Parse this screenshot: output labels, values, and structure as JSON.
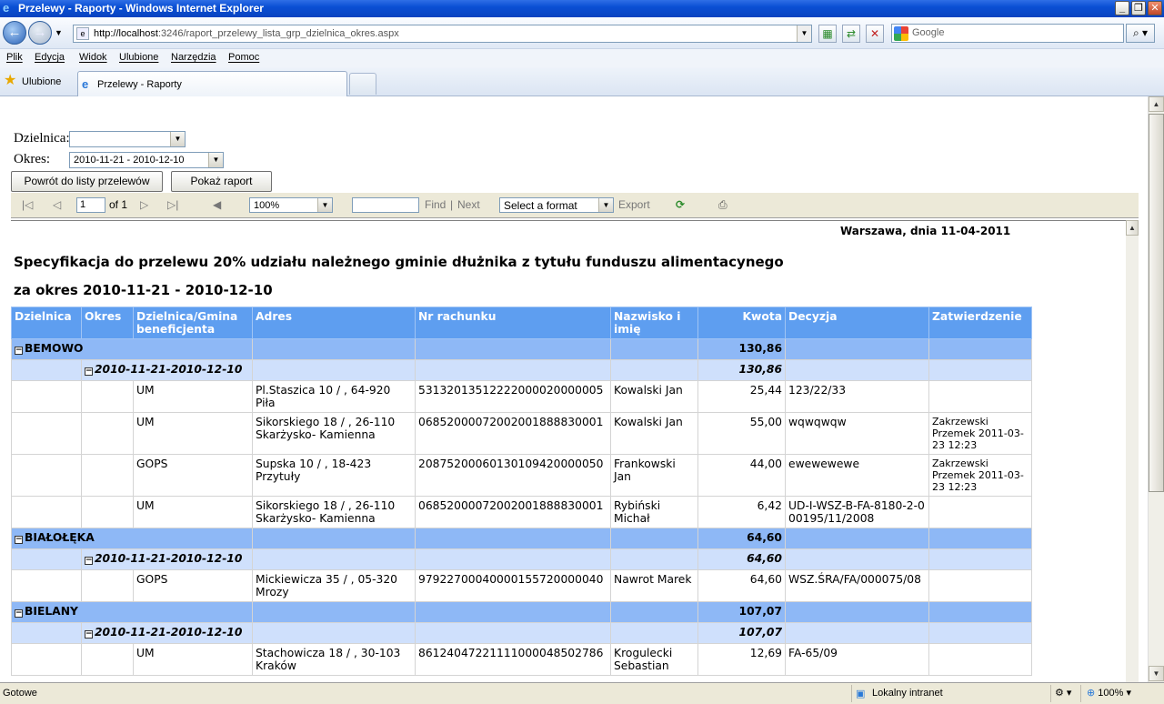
{
  "window": {
    "title": "Przelewy - Raporty - Windows Internet Explorer"
  },
  "address": {
    "host": "http://localhost",
    "rest": ":3246/raport_przelewy_lista_grp_dzielnica_okres.aspx"
  },
  "search": {
    "placeholder": "Google"
  },
  "menu": [
    "Plik",
    "Edycja",
    "Widok",
    "Ulubione",
    "Narzędzia",
    "Pomoc"
  ],
  "favorites": {
    "label": "Ulubione"
  },
  "tab": {
    "title": "Przelewy - Raporty"
  },
  "form": {
    "dzielnica_label": "Dzielnica:",
    "dzielnica_value": "",
    "okres_label": "Okres:",
    "okres_value": "2010-11-21 - 2010-12-10",
    "back_button": "Powrót do listy przelewów",
    "show_button": "Pokaż raport"
  },
  "toolbar": {
    "page_value": "1",
    "of_pages": "of 1",
    "zoom": "100%",
    "find": "Find",
    "separator": "|",
    "next": "Next",
    "format": "Select a format",
    "export": "Export"
  },
  "report": {
    "dateline": "Warszawa, dnia 11-04-2011",
    "title1": "Specyfikacja do przelewu 20% udziału należnego gminie dłużnika z tytułu funduszu alimentacynego",
    "title2": "za okres 2010-11-21 - 2010-12-10",
    "headers": [
      "Dzielnica",
      "Okres",
      "Dzielnica/Gmina beneficjenta",
      "Adres",
      "Nr rachunku",
      "Nazwisko i imię",
      "Kwota",
      "Decyzja",
      "Zatwierdzenie"
    ],
    "groups": [
      {
        "name": "BEMOWO",
        "total": "130,86",
        "period": "2010-11-21-2010-12-10",
        "period_total": "130,86",
        "rows": [
          {
            "gmina": "UM",
            "adres": "Pl.Staszica 10 / , 64-920 Piła",
            "rachunek": "53132013512222000020000005",
            "nazwisko": "Kowalski Jan",
            "kwota": "25,44",
            "decyzja": "123/22/33",
            "zatw": ""
          },
          {
            "gmina": "UM",
            "adres": "Sikorskiego 18 / , 26-110 Skarżysko- Kamienna",
            "rachunek": "06852000072002001888830001",
            "nazwisko": "Kowalski Jan",
            "kwota": "55,00",
            "decyzja": "wqwqwqw",
            "zatw": "Zakrzewski Przemek 2011-03-23 12:23"
          },
          {
            "gmina": "GOPS",
            "adres": "Supska 10 / , 18-423 Przytuły",
            "rachunek": "20875200060130109420000050",
            "nazwisko": "Frankowski Jan",
            "kwota": "44,00",
            "decyzja": "ewewewewe",
            "zatw": "Zakrzewski Przemek 2011-03-23 12:23"
          },
          {
            "gmina": "UM",
            "adres": "Sikorskiego 18 / , 26-110 Skarżysko- Kamienna",
            "rachunek": "06852000072002001888830001",
            "nazwisko": "Rybiński Michał",
            "kwota": "6,42",
            "decyzja": "UD-I-WSZ-B-FA-8180-2-000195/11/2008",
            "zatw": ""
          }
        ]
      },
      {
        "name": "BIAŁOŁĘKA",
        "total": "64,60",
        "period": "2010-11-21-2010-12-10",
        "period_total": "64,60",
        "rows": [
          {
            "gmina": "GOPS",
            "adres": "Mickiewicza 35 / , 05-320 Mrozy",
            "rachunek": "97922700040000155720000040",
            "nazwisko": "Nawrot Marek",
            "kwota": "64,60",
            "decyzja": "WSZ.ŚRA/FA/000075/08",
            "zatw": ""
          }
        ]
      },
      {
        "name": "BIELANY",
        "total": "107,07",
        "period": "2010-11-21-2010-12-10",
        "period_total": "107,07",
        "rows": [
          {
            "gmina": "UM",
            "adres": "Stachowicza 18 / , 30-103 Kraków",
            "rachunek": "86124047221111000048502786",
            "nazwisko": "Krogulecki Sebastian",
            "kwota": "12,69",
            "decyzja": "FA-65/09",
            "zatw": ""
          }
        ]
      }
    ]
  },
  "status": {
    "text": "Gotowe",
    "zone": "Lokalny intranet",
    "zoom": "100%"
  }
}
